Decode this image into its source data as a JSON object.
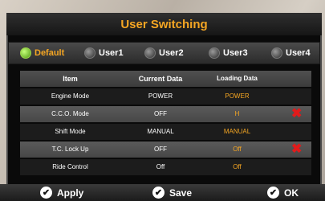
{
  "title": "User Switching",
  "users": [
    {
      "label": "Default",
      "selected": true
    },
    {
      "label": "User1",
      "selected": false
    },
    {
      "label": "User2",
      "selected": false
    },
    {
      "label": "User3",
      "selected": false
    },
    {
      "label": "User4",
      "selected": false
    }
  ],
  "table": {
    "headers": {
      "item": "Item",
      "current": "Current Data",
      "loading": "Loading Data"
    },
    "rows": [
      {
        "item": "Engine Mode",
        "current": "POWER",
        "loading": "POWER",
        "mismatch": false
      },
      {
        "item": "C.C.O. Mode",
        "current": "OFF",
        "loading": "H",
        "mismatch": true
      },
      {
        "item": "Shift Mode",
        "current": "MANUAL",
        "loading": "MANUAL",
        "mismatch": false
      },
      {
        "item": "T.C. Lock Up",
        "current": "OFF",
        "loading": "Off",
        "mismatch": true
      },
      {
        "item": "Ride Control",
        "current": "Off",
        "loading": "Off",
        "mismatch": false
      }
    ]
  },
  "buttons": {
    "apply": "Apply",
    "save": "Save",
    "ok": "OK"
  },
  "colors": {
    "accent": "#f5a623",
    "mismatch": "#e21b1b",
    "selected_radio": "#6cc11f"
  }
}
